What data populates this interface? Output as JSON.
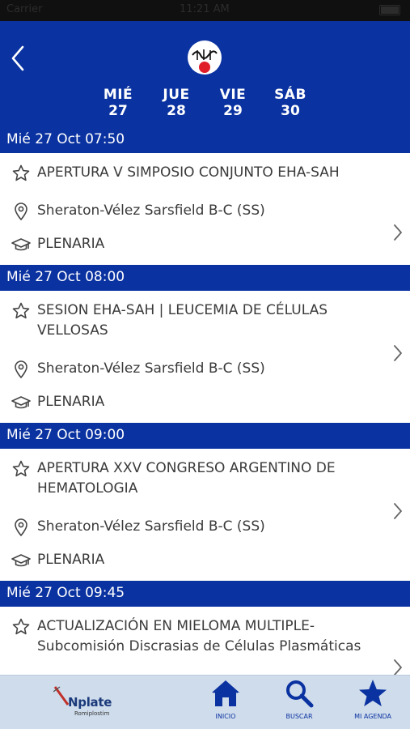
{
  "status_bar": {
    "carrier": "Carrier",
    "time": "11:21 AM"
  },
  "header": {
    "days": [
      {
        "name": "MIÉ",
        "num": "27"
      },
      {
        "name": "JUE",
        "num": "28"
      },
      {
        "name": "VIE",
        "num": "29"
      },
      {
        "name": "SÁB",
        "num": "30"
      }
    ]
  },
  "agenda": [
    {
      "time": "Mié 27 Oct 07:50",
      "title": "APERTURA V SIMPOSIO CONJUNTO EHA-SAH",
      "location": "Sheraton-Vélez Sarsfield B-C (SS)",
      "type": "PLENARIA"
    },
    {
      "time": "Mié 27 Oct 08:00",
      "title": "SESION EHA-SAH | LEUCEMIA DE CÉLULAS VELLOSAS",
      "location": "Sheraton-Vélez Sarsfield B-C (SS)",
      "type": "PLENARIA"
    },
    {
      "time": "Mié 27 Oct 09:00",
      "title": "APERTURA XXV CONGRESO ARGENTINO DE HEMATOLOGIA",
      "location": "Sheraton-Vélez Sarsfield B-C (SS)",
      "type": "PLENARIA"
    },
    {
      "time": "Mié 27 Oct 09:45",
      "title": "ACTUALIZACIÓN EN MIELOMA MULTIPLE- Subcomisión Discrasias de Células Plasmáticas",
      "location": "",
      "type": ""
    }
  ],
  "footer": {
    "sponsor": {
      "brand": "Nplate",
      "sub": "Romiplostim"
    },
    "tabs": [
      {
        "label": "INICIO",
        "icon": "home-icon"
      },
      {
        "label": "BUSCAR",
        "icon": "search-icon"
      },
      {
        "label": "MI AGENDA",
        "icon": "star-icon"
      }
    ]
  },
  "colors": {
    "primary": "#0a32a0",
    "accent_red": "#e01e2a",
    "tabbar_bg": "#cfdcec"
  }
}
